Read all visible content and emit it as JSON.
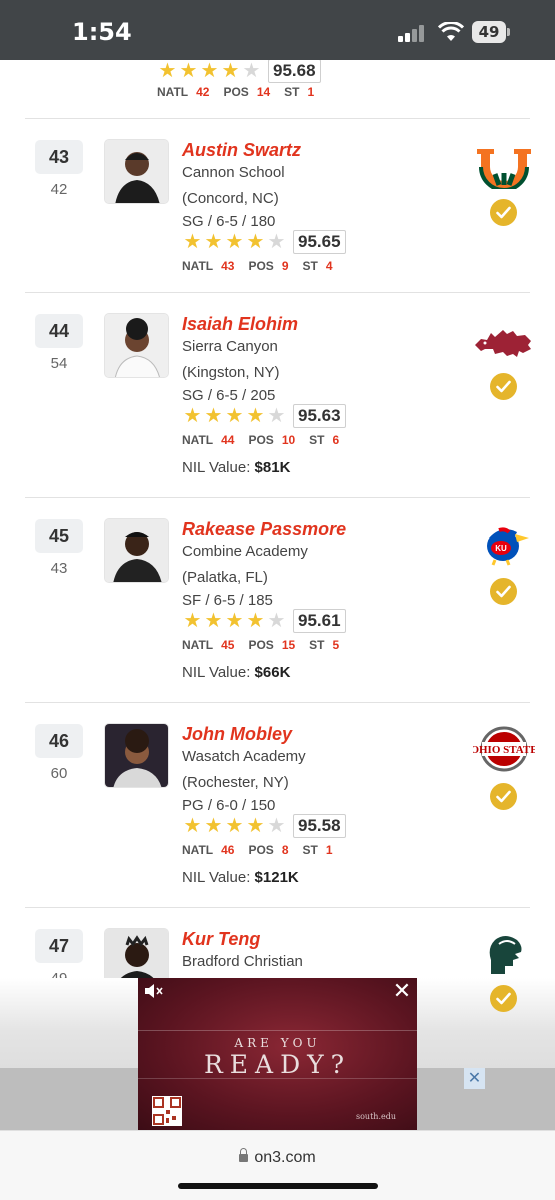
{
  "status_bar": {
    "time": "1:54",
    "battery": "49"
  },
  "top_partial": {
    "stars_filled": 4,
    "stars_total": 5,
    "score": "95.68",
    "natl_label": "NATL",
    "natl": "42",
    "pos_label": "POS",
    "pos": "14",
    "st_label": "ST",
    "st": "1"
  },
  "players": [
    {
      "rank": "43",
      "prev_rank": "42",
      "name": "Austin Swartz",
      "school": "Cannon School",
      "hometown": "(Concord, NC)",
      "measurables": "SG / 6-5 / 180",
      "stars_filled": 4,
      "score": "95.65",
      "natl": "43",
      "pos": "9",
      "st": "4",
      "school_logo_icon": "miami-u-logo-icon",
      "committed_icon": "check-circle-icon"
    },
    {
      "rank": "44",
      "prev_rank": "54",
      "name": "Isaiah Elohim",
      "school": "Sierra Canyon",
      "hometown": "(Kingston, NY)",
      "measurables": "SG / 6-5 / 205",
      "stars_filled": 4,
      "score": "95.63",
      "natl": "44",
      "pos": "10",
      "st": "6",
      "nil_label": "NIL Value:",
      "nil_value": "$81K",
      "school_logo_icon": "arkansas-razorback-logo-icon",
      "committed_icon": "check-circle-icon"
    },
    {
      "rank": "45",
      "prev_rank": "43",
      "name": "Rakease Passmore",
      "school": "Combine Academy",
      "hometown": "(Palatka, FL)",
      "measurables": "SF / 6-5 / 185",
      "stars_filled": 4,
      "score": "95.61",
      "natl": "45",
      "pos": "15",
      "st": "5",
      "nil_label": "NIL Value:",
      "nil_value": "$66K",
      "school_logo_icon": "kansas-jayhawk-logo-icon",
      "committed_icon": "check-circle-icon"
    },
    {
      "rank": "46",
      "prev_rank": "60",
      "name": "John Mobley",
      "school": "Wasatch Academy",
      "hometown": "(Rochester, NY)",
      "measurables": "PG / 6-0 / 150",
      "stars_filled": 4,
      "score": "95.58",
      "natl": "46",
      "pos": "8",
      "st": "1",
      "nil_label": "NIL Value:",
      "nil_value": "$121K",
      "school_logo_icon": "ohio-state-logo-icon",
      "committed_icon": "check-circle-icon"
    },
    {
      "rank": "47",
      "prev_rank": "49",
      "name": "Kur Teng",
      "school": "Bradford Christian",
      "school_logo_icon": "michigan-state-spartan-logo-icon",
      "committed_icon": "check-circle-icon"
    }
  ],
  "labels": {
    "natl": "NATL",
    "pos": "POS",
    "st": "ST"
  },
  "ad": {
    "line1": "ARE YOU",
    "line2": "READY?",
    "small": "south.edu"
  },
  "browser": {
    "url": "on3.com"
  },
  "colors": {
    "accent": "#e1341e",
    "star": "#f2c230",
    "check": "#e5b52b",
    "status_bar": "#414548"
  }
}
